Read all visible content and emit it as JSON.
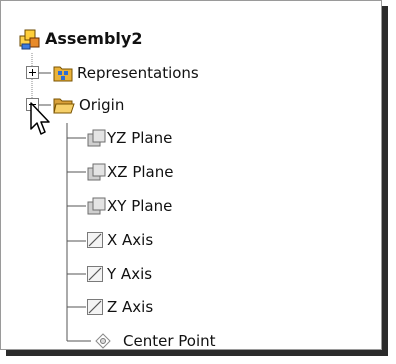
{
  "tree": {
    "root": {
      "label": "Assembly2",
      "icon": "assembly-icon"
    },
    "nodes": [
      {
        "label": "Representations",
        "icon": "representations-icon",
        "expander": "plus",
        "level": 1
      },
      {
        "label": "Origin",
        "icon": "folder-open-icon",
        "expander": "minus",
        "level": 1
      },
      {
        "label": "YZ Plane",
        "icon": "plane-icon",
        "level": 2
      },
      {
        "label": "XZ Plane",
        "icon": "plane-icon",
        "level": 2
      },
      {
        "label": "XY Plane",
        "icon": "plane-icon",
        "level": 2
      },
      {
        "label": "X Axis",
        "icon": "axis-icon",
        "level": 2
      },
      {
        "label": "Y Axis",
        "icon": "axis-icon",
        "level": 2
      },
      {
        "label": "Z Axis",
        "icon": "axis-icon",
        "level": 2
      },
      {
        "label": "Center Point",
        "icon": "point-icon",
        "level": 2
      }
    ]
  },
  "colors": {
    "frame_border": "#9a9a9a",
    "shadow": "#2b2b2b",
    "tree_line": "#8a8a8a",
    "folder": "#f2c94c",
    "assembly_yellow": "#ffd34a",
    "assembly_orange": "#e88a2a"
  }
}
